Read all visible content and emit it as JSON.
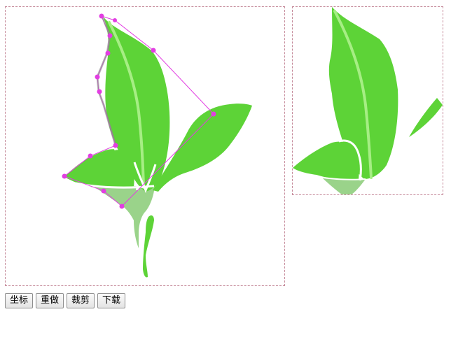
{
  "toolbar": {
    "coords_label": "坐标",
    "redo_label": "重做",
    "crop_label": "裁剪",
    "download_label": "下载"
  },
  "colors": {
    "leaf": "#5dd337",
    "leaf_light": "#a6ee84",
    "stem_pale": "#9ad38a",
    "selection": "#e23ee2",
    "canvas_border": "#c58a9a"
  }
}
